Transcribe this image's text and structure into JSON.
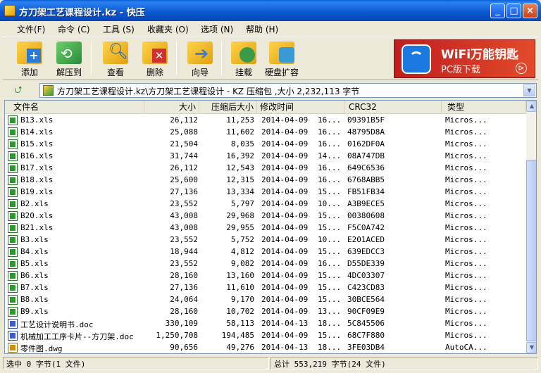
{
  "window": {
    "title": "方刀架工艺课程设计.kz - 快压",
    "minimize": "_",
    "maximize": "□",
    "close": "×"
  },
  "menu": [
    "文件(F)",
    "命令 (C)",
    "工具 (S)",
    "收藏夹 (O)",
    "选项 (N)",
    "帮助 (H)"
  ],
  "toolbar": [
    {
      "label": "添加",
      "icon": "add-icon",
      "color": "#2a7ad8"
    },
    {
      "label": "解压到",
      "icon": "extract-icon",
      "color": "#2aa04a"
    },
    {
      "label": "查看",
      "icon": "view-icon",
      "color": "#3a8ad0"
    },
    {
      "label": "删除",
      "icon": "delete-icon",
      "color": "#d03030"
    },
    {
      "label": "向导",
      "icon": "wizard-icon",
      "color": "#e09020"
    },
    {
      "label": "挂载",
      "icon": "mount-icon",
      "color": "#4aa04a"
    },
    {
      "label": "硬盘扩容",
      "icon": "disk-expand-icon",
      "color": "#3a9ad8"
    }
  ],
  "ad": {
    "title": "WiFi万能钥匙",
    "subtitle": "PC版下载",
    "arrow": "⊳"
  },
  "address": {
    "up_glyph": "⮍",
    "path": "方刀架工艺课程设计.kz\\方刀架工艺课程设计 - KZ 压缩包 ,大小 2,232,113 字节",
    "drop": "▼"
  },
  "columns": [
    "文件名",
    "大小",
    "压缩后大小",
    "修改时间",
    "CRC32",
    "类型"
  ],
  "files": [
    {
      "name": "B13.xls",
      "size": "26,112",
      "packed": "11,253",
      "date": "2014-04-09",
      "time": "16...",
      "crc": "09391B5F",
      "type": "Micros...",
      "kind": "xls"
    },
    {
      "name": "B14.xls",
      "size": "25,088",
      "packed": "11,602",
      "date": "2014-04-09",
      "time": "16...",
      "crc": "48795D8A",
      "type": "Micros...",
      "kind": "xls"
    },
    {
      "name": "B15.xls",
      "size": "21,504",
      "packed": "8,035",
      "date": "2014-04-09",
      "time": "16...",
      "crc": "0162DF0A",
      "type": "Micros...",
      "kind": "xls"
    },
    {
      "name": "B16.xls",
      "size": "31,744",
      "packed": "16,392",
      "date": "2014-04-09",
      "time": "14...",
      "crc": "08A747DB",
      "type": "Micros...",
      "kind": "xls"
    },
    {
      "name": "B17.xls",
      "size": "26,112",
      "packed": "12,543",
      "date": "2014-04-09",
      "time": "16...",
      "crc": "649C6536",
      "type": "Micros...",
      "kind": "xls"
    },
    {
      "name": "B18.xls",
      "size": "25,600",
      "packed": "12,315",
      "date": "2014-04-09",
      "time": "16...",
      "crc": "6768ABB5",
      "type": "Micros...",
      "kind": "xls"
    },
    {
      "name": "B19.xls",
      "size": "27,136",
      "packed": "13,334",
      "date": "2014-04-09",
      "time": "15...",
      "crc": "FB51FB34",
      "type": "Micros...",
      "kind": "xls"
    },
    {
      "name": "B2.xls",
      "size": "23,552",
      "packed": "5,797",
      "date": "2014-04-09",
      "time": "10...",
      "crc": "A3B9ECE5",
      "type": "Micros...",
      "kind": "xls"
    },
    {
      "name": "B20.xls",
      "size": "43,008",
      "packed": "29,968",
      "date": "2014-04-09",
      "time": "15...",
      "crc": "00380608",
      "type": "Micros...",
      "kind": "xls"
    },
    {
      "name": "B21.xls",
      "size": "43,008",
      "packed": "29,955",
      "date": "2014-04-09",
      "time": "15...",
      "crc": "F5C0A742",
      "type": "Micros...",
      "kind": "xls"
    },
    {
      "name": "B3.xls",
      "size": "23,552",
      "packed": "5,752",
      "date": "2014-04-09",
      "time": "10...",
      "crc": "E201ACED",
      "type": "Micros...",
      "kind": "xls"
    },
    {
      "name": "B4.xls",
      "size": "18,944",
      "packed": "4,812",
      "date": "2014-04-09",
      "time": "15...",
      "crc": "639EDCC3",
      "type": "Micros...",
      "kind": "xls"
    },
    {
      "name": "B5.xls",
      "size": "23,552",
      "packed": "9,082",
      "date": "2014-04-09",
      "time": "16...",
      "crc": "D55DE339",
      "type": "Micros...",
      "kind": "xls"
    },
    {
      "name": "B6.xls",
      "size": "28,160",
      "packed": "13,160",
      "date": "2014-04-09",
      "time": "15...",
      "crc": "4DC03307",
      "type": "Micros...",
      "kind": "xls"
    },
    {
      "name": "B7.xls",
      "size": "27,136",
      "packed": "11,610",
      "date": "2014-04-09",
      "time": "15...",
      "crc": "C423CD83",
      "type": "Micros...",
      "kind": "xls"
    },
    {
      "name": "B8.xls",
      "size": "24,064",
      "packed": "9,170",
      "date": "2014-04-09",
      "time": "15...",
      "crc": "30BCE564",
      "type": "Micros...",
      "kind": "xls"
    },
    {
      "name": "B9.xls",
      "size": "28,160",
      "packed": "10,702",
      "date": "2014-04-09",
      "time": "13...",
      "crc": "90CF09E9",
      "type": "Micros...",
      "kind": "xls"
    },
    {
      "name": "工艺设计说明书.doc",
      "size": "330,109",
      "packed": "58,113",
      "date": "2014-04-13",
      "time": "18...",
      "crc": "5C845506",
      "type": "Micros...",
      "kind": "doc"
    },
    {
      "name": "机械加工工序卡片--方刀架.doc",
      "size": "1,250,708",
      "packed": "194,485",
      "date": "2014-04-09",
      "time": "15...",
      "crc": "68C7F880",
      "type": "Micros...",
      "kind": "doc"
    },
    {
      "name": "零件图.dwg",
      "size": "90,656",
      "packed": "49,276",
      "date": "2014-04-13",
      "time": "18...",
      "crc": "3FE03DB4",
      "type": "AutoCA...",
      "kind": "dwg"
    }
  ],
  "scroll": {
    "up": "▲",
    "down": "▼"
  },
  "status": {
    "left": "选中   0 字节(1 文件)",
    "right": "总计   553,219 字节(24 文件)"
  }
}
